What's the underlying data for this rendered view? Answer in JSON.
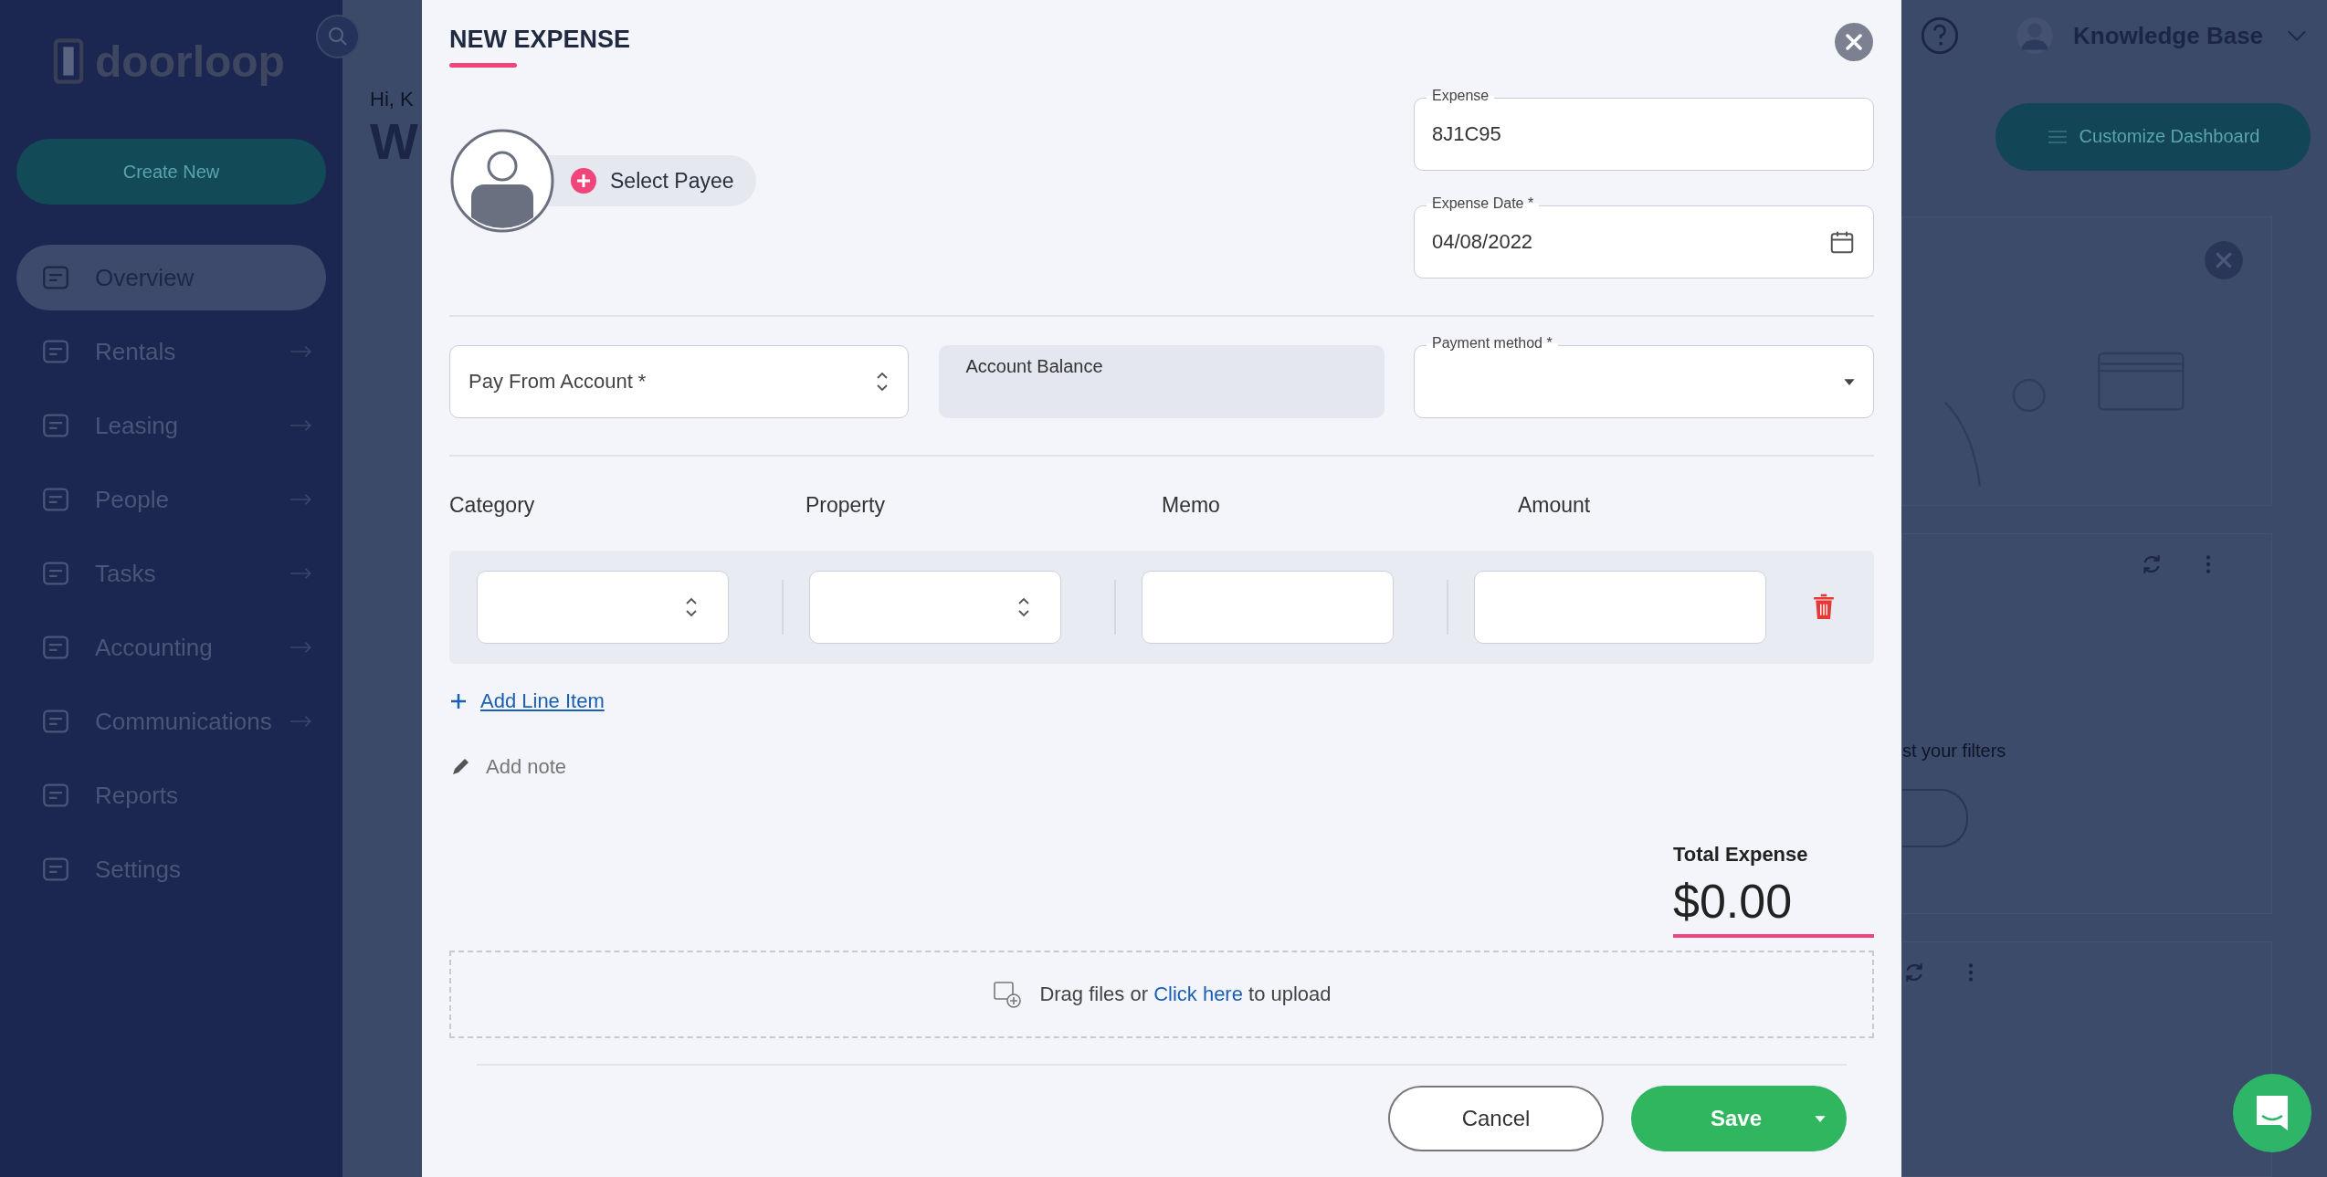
{
  "sidebar": {
    "logo": "doorloop",
    "create_button": "Create New",
    "items": [
      {
        "label": "Overview",
        "selected": true,
        "expandable": false
      },
      {
        "label": "Rentals",
        "selected": false,
        "expandable": true
      },
      {
        "label": "Leasing",
        "selected": false,
        "expandable": true
      },
      {
        "label": "People",
        "selected": false,
        "expandable": true
      },
      {
        "label": "Tasks",
        "selected": false,
        "expandable": true
      },
      {
        "label": "Accounting",
        "selected": false,
        "expandable": true
      },
      {
        "label": "Communications",
        "selected": false,
        "expandable": true
      },
      {
        "label": "Reports",
        "selected": false,
        "expandable": false
      },
      {
        "label": "Settings",
        "selected": false,
        "expandable": false
      }
    ]
  },
  "background": {
    "greeting": "Hi, K",
    "heading": "W",
    "user": "Knowledge Base",
    "customize_button": "Customize Dashboard",
    "filter_hint": "st your filters"
  },
  "dialog": {
    "title": "NEW EXPENSE",
    "payee_button": "Select Payee",
    "expense": {
      "label": "Expense",
      "value": "8J1C95"
    },
    "expense_date": {
      "label": "Expense Date *",
      "value": "04/08/2022"
    },
    "pay_from_account": {
      "placeholder": "Pay From Account *"
    },
    "account_balance": {
      "label": "Account Balance"
    },
    "payment_method": {
      "label": "Payment method *"
    },
    "line_items": {
      "columns": [
        "Category",
        "Property",
        "Memo",
        "Amount"
      ],
      "rows": [
        {
          "cells": [
            {
              "kind": "select"
            },
            {
              "kind": "select"
            },
            {
              "kind": "text"
            },
            {
              "kind": "text"
            }
          ]
        }
      ]
    },
    "add_line_item": "Add Line Item",
    "add_note": "Add note",
    "total": {
      "label": "Total Expense",
      "value": "$0.00"
    },
    "upload": {
      "before": "Drag files or",
      "link": "Click here",
      "after": "to upload"
    },
    "buttons": {
      "cancel": "Cancel",
      "save": "Save"
    }
  }
}
